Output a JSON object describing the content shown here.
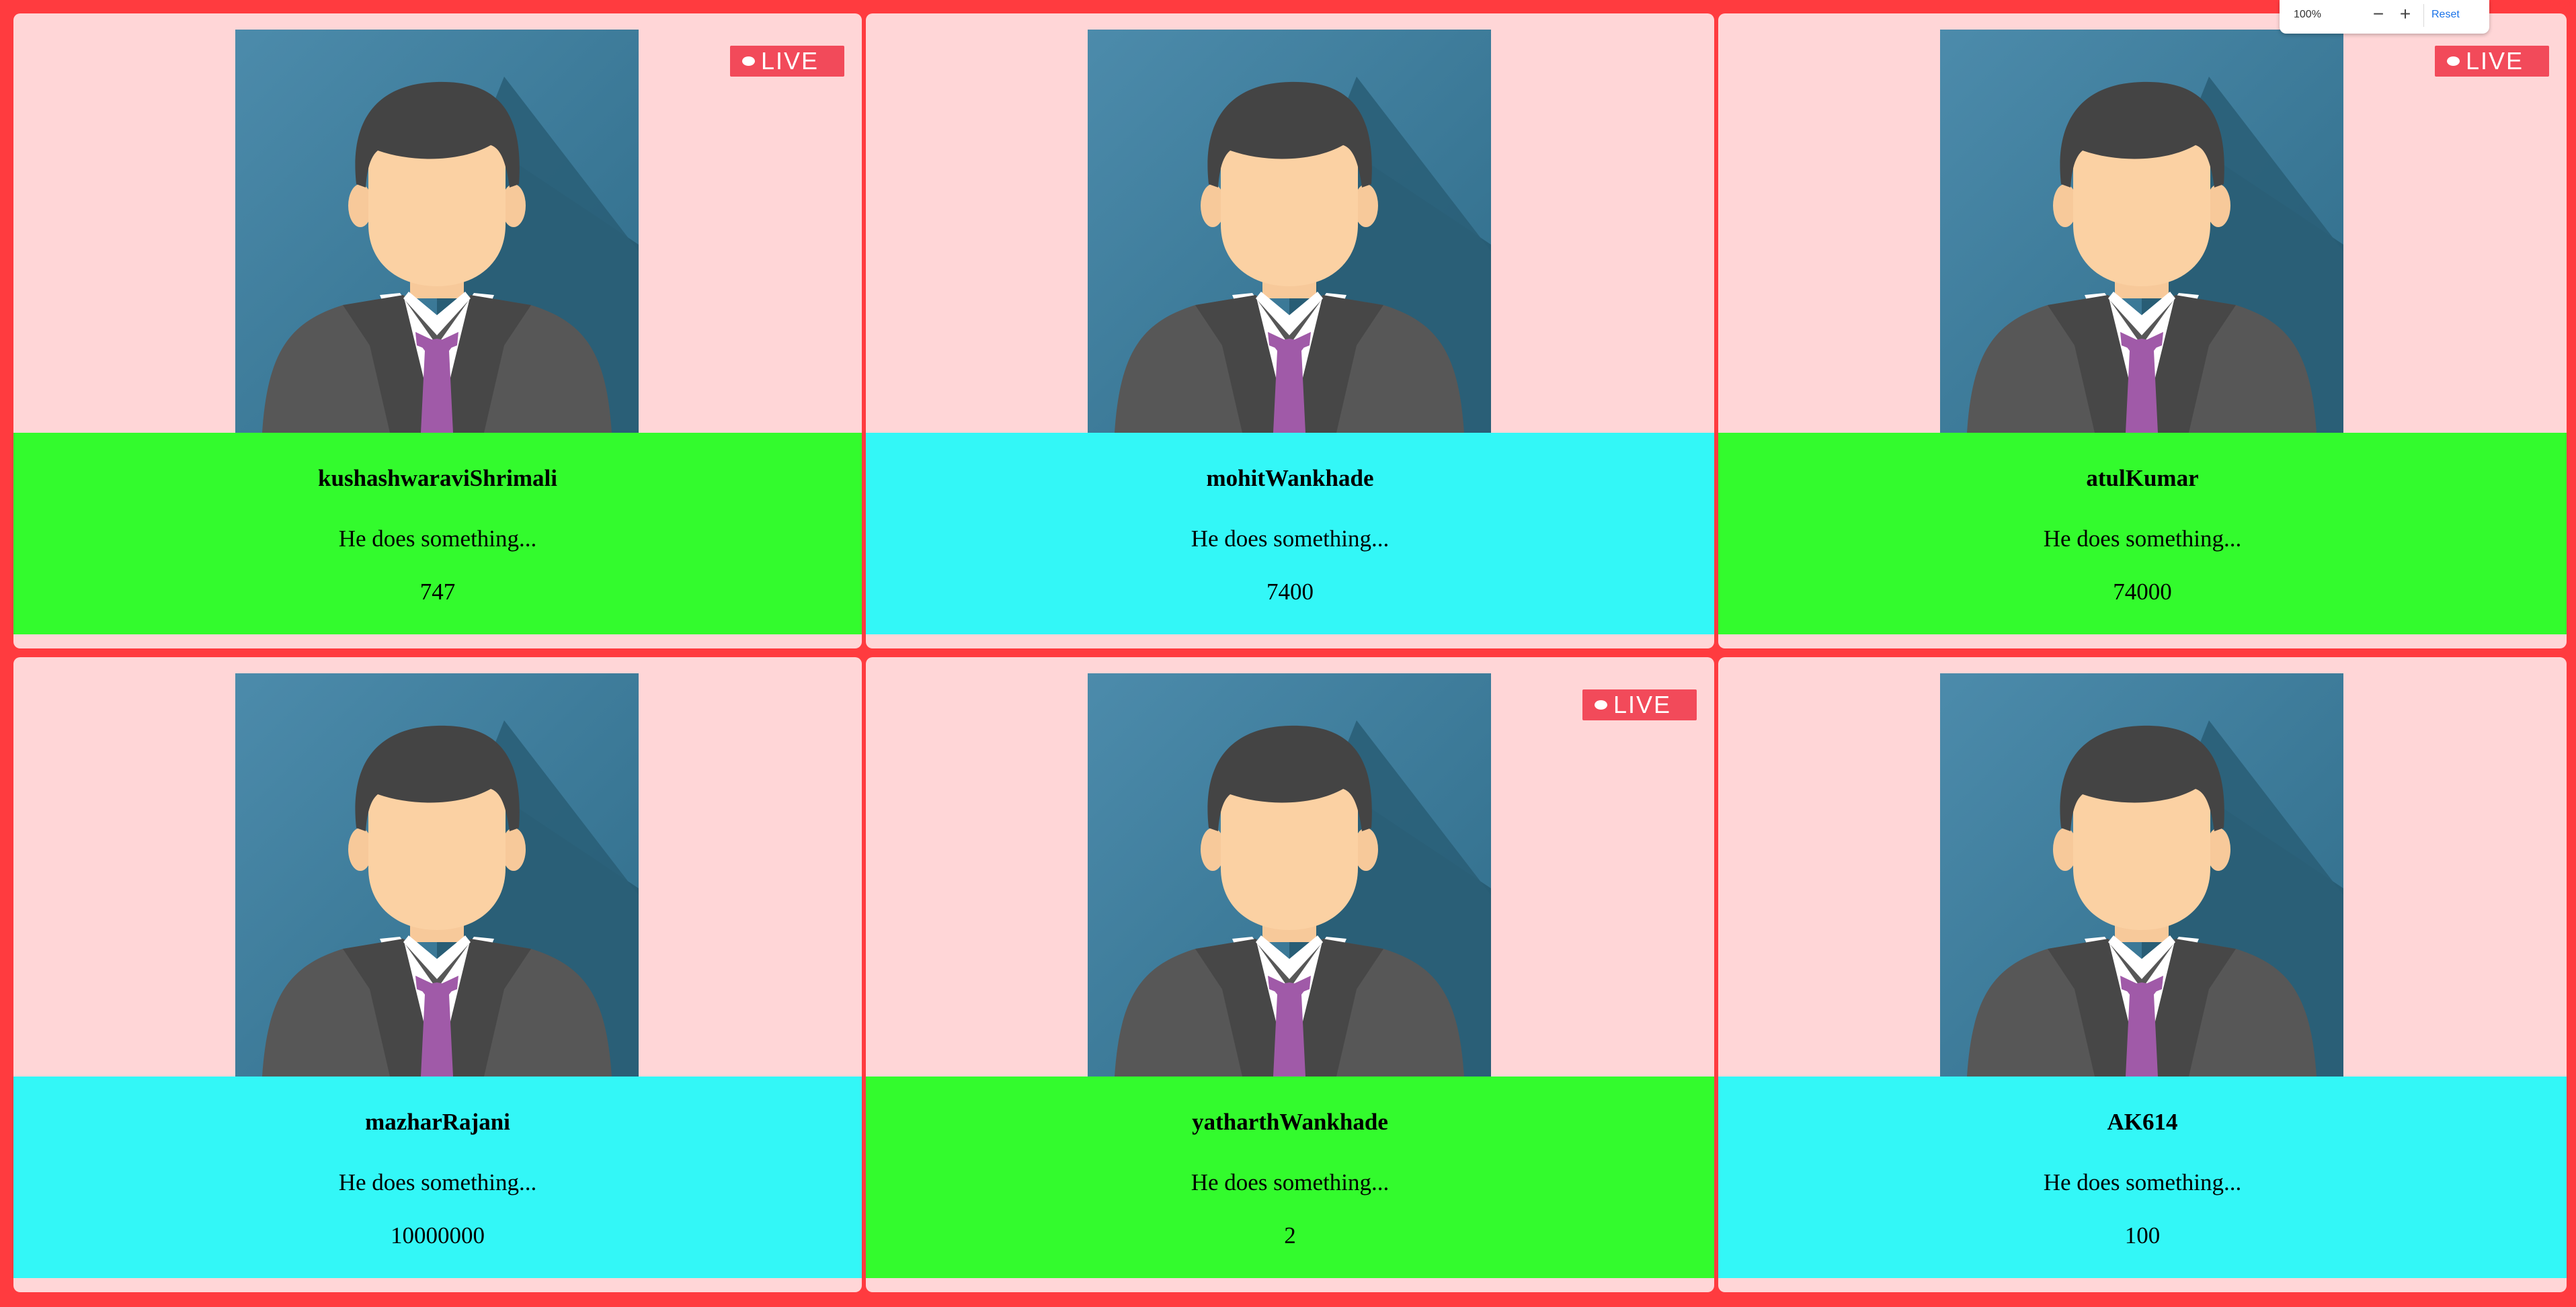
{
  "colors": {
    "page_background": "#ff3b3f",
    "card_background": "#ffd6d7",
    "info_green": "#33fb2d",
    "info_cyan": "#33f7f7",
    "live_badge": "#f24a5a",
    "reset_link": "#1a73e8"
  },
  "cards": [
    {
      "name": "kushashwaraviShrimali",
      "description": "He does something...",
      "count": "747",
      "live": true,
      "info_color": "green",
      "live_label": "LIVE",
      "avatar_icon": "businessman-avatar-icon"
    },
    {
      "name": "mohitWankhade",
      "description": "He does something...",
      "count": "7400",
      "live": false,
      "info_color": "cyan",
      "avatar_icon": "businessman-avatar-icon"
    },
    {
      "name": "atulKumar",
      "description": "He does something...",
      "count": "74000",
      "live": true,
      "info_color": "green",
      "live_label": "LIVE",
      "avatar_icon": "businessman-avatar-icon"
    },
    {
      "name": "mazharRajani",
      "description": "He does something...",
      "count": "10000000",
      "live": false,
      "info_color": "cyan",
      "avatar_icon": "businessman-avatar-icon"
    },
    {
      "name": "yatharthWankhade",
      "description": "He does something...",
      "count": "2",
      "live": true,
      "info_color": "green",
      "live_label": "LIVE",
      "avatar_icon": "businessman-avatar-icon"
    },
    {
      "name": "AK614",
      "description": "He does something...",
      "count": "100",
      "live": false,
      "info_color": "cyan",
      "avatar_icon": "businessman-avatar-icon"
    }
  ],
  "zoom_widget": {
    "level": "100%",
    "zoom_out_label": "−",
    "zoom_in_label": "+",
    "reset_label": "Reset"
  }
}
